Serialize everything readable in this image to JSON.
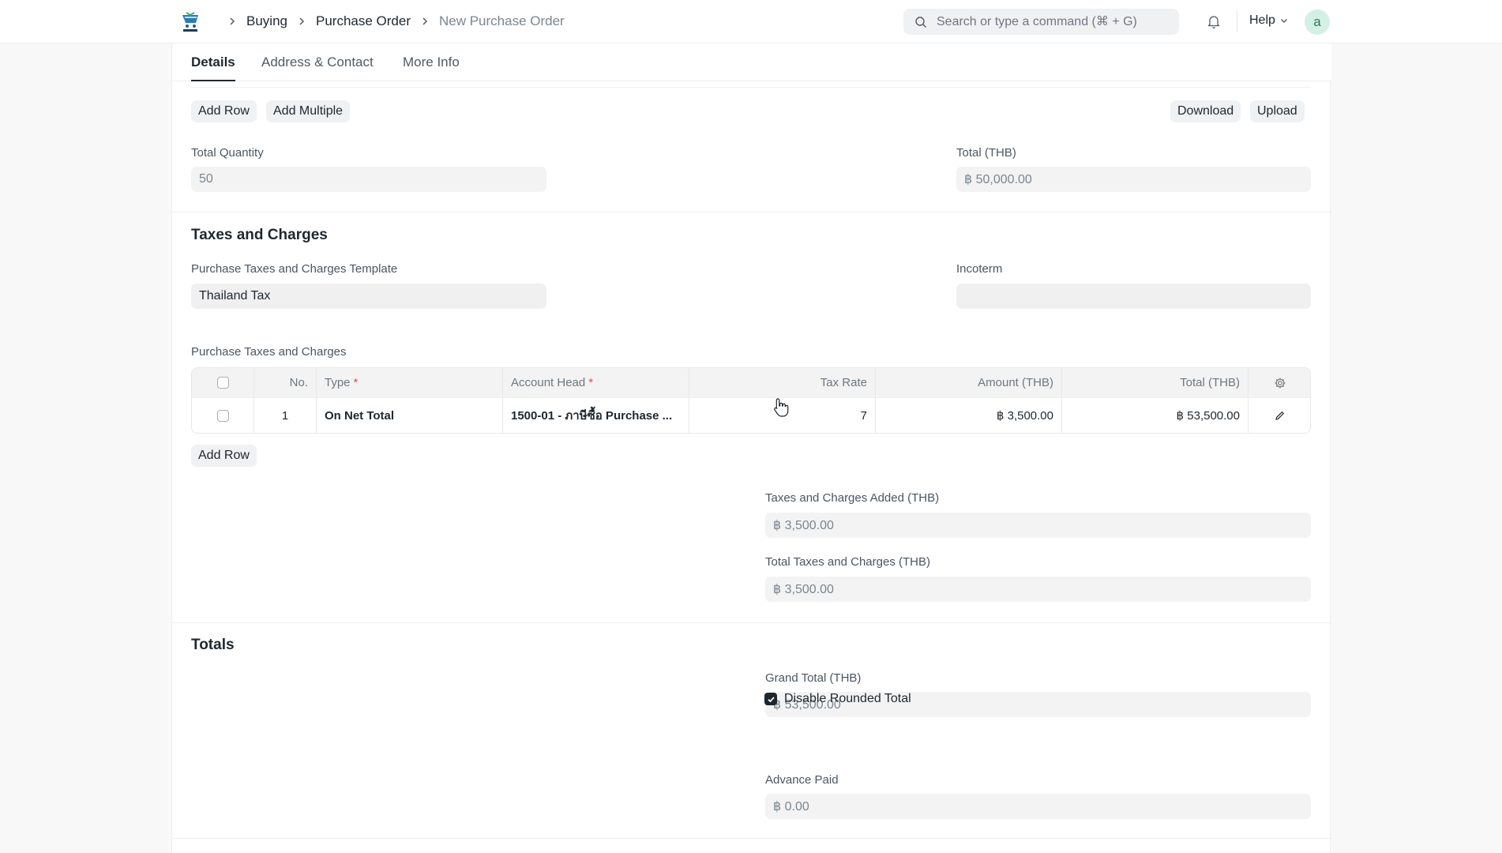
{
  "navbar": {
    "breadcrumbs": [
      "Buying",
      "Purchase Order",
      "New Purchase Order"
    ],
    "search_placeholder": "Search or type a command (⌘ + G)",
    "help_label": "Help",
    "avatar_initial": "a"
  },
  "tabs": [
    "Details",
    "Address & Contact",
    "More Info"
  ],
  "items_toolbar": {
    "add_row": "Add Row",
    "add_multiple": "Add Multiple",
    "download": "Download",
    "upload": "Upload"
  },
  "quantities": {
    "total_quantity_label": "Total Quantity",
    "total_quantity_value": "50",
    "total_label": "Total (THB)",
    "total_value": "฿ 50,000.00"
  },
  "taxes_section": {
    "title": "Taxes and Charges",
    "template_label": "Purchase Taxes and Charges Template",
    "template_value": "Thailand Tax",
    "incoterm_label": "Incoterm",
    "incoterm_value": "",
    "table_label": "Purchase Taxes and Charges",
    "columns": {
      "no": "No.",
      "type": "Type",
      "account_head": "Account Head",
      "tax_rate": "Tax Rate",
      "amount": "Amount (THB)",
      "total": "Total (THB)",
      "required_mark": "*"
    },
    "rows": [
      {
        "no": "1",
        "type": "On Net Total",
        "account_head": "1500-01 - ภาษีซื้อ Purchase ...",
        "tax_rate": "7",
        "amount": "฿ 3,500.00",
        "total": "฿ 53,500.00"
      }
    ],
    "add_row": "Add Row",
    "added_label": "Taxes and Charges Added (THB)",
    "added_value": "฿ 3,500.00",
    "total_taxes_label": "Total Taxes and Charges (THB)",
    "total_taxes_value": "฿ 3,500.00"
  },
  "totals_section": {
    "title": "Totals",
    "grand_total_label": "Grand Total (THB)",
    "grand_total_value": "฿ 53,500.00",
    "disable_rounded_label": "Disable Rounded Total",
    "disable_rounded_checked": true,
    "advance_paid_label": "Advance Paid",
    "advance_paid_value": "฿ 0.00"
  },
  "colors": {
    "field_bg": "#f3f3f3",
    "text": "#1f272e",
    "muted": "#7c858f",
    "required": "#e24c4c",
    "avatar_bg": "#d4f0e5"
  }
}
